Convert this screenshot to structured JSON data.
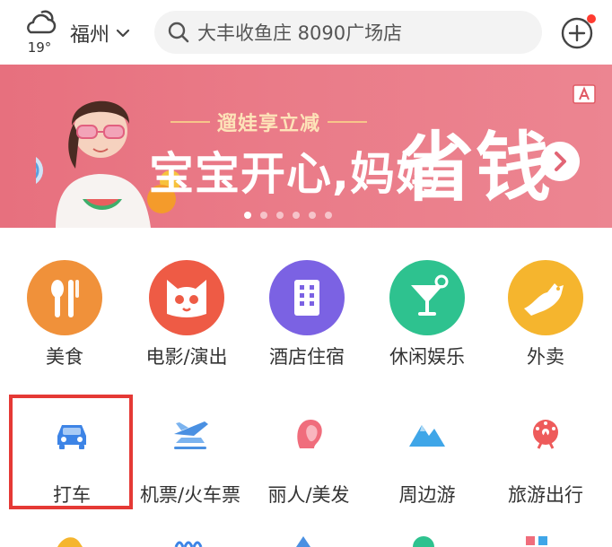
{
  "header": {
    "temperature": "19°",
    "city": "福州",
    "search_text": "大丰收鱼庄 8090广场店"
  },
  "banner": {
    "subtitle": "遛娃享立减",
    "headline_left": "宝宝开心,妈妈",
    "headline_right": "省钱",
    "active_dot": 0,
    "dot_count": 6
  },
  "categories_primary": [
    {
      "label": "美食",
      "color": "#f0913a",
      "icon": "utensils-icon"
    },
    {
      "label": "电影/演出",
      "color": "#ee5b45",
      "icon": "cat-face-icon"
    },
    {
      "label": "酒店住宿",
      "color": "#7b62e3",
      "icon": "building-icon"
    },
    {
      "label": "休闲娱乐",
      "color": "#2ec28f",
      "icon": "cocktail-icon"
    },
    {
      "label": "外卖",
      "color": "#f5b52e",
      "icon": "kangaroo-icon"
    }
  ],
  "categories_secondary": [
    {
      "label": "打车",
      "color": "#3d84e6",
      "icon": "car-icon"
    },
    {
      "label": "机票/火车票",
      "color": "#4a90e2",
      "icon": "plane-train-icon"
    },
    {
      "label": "丽人/美发",
      "color": "#f06d7c",
      "icon": "woman-head-icon"
    },
    {
      "label": "周边游",
      "color": "#3fa6e8",
      "icon": "mountain-icon"
    },
    {
      "label": "旅游出行",
      "color": "#ee5b5b",
      "icon": "ferris-wheel-icon"
    }
  ],
  "colors": {
    "highlight": "#e53935",
    "banner": "#e7707e"
  }
}
